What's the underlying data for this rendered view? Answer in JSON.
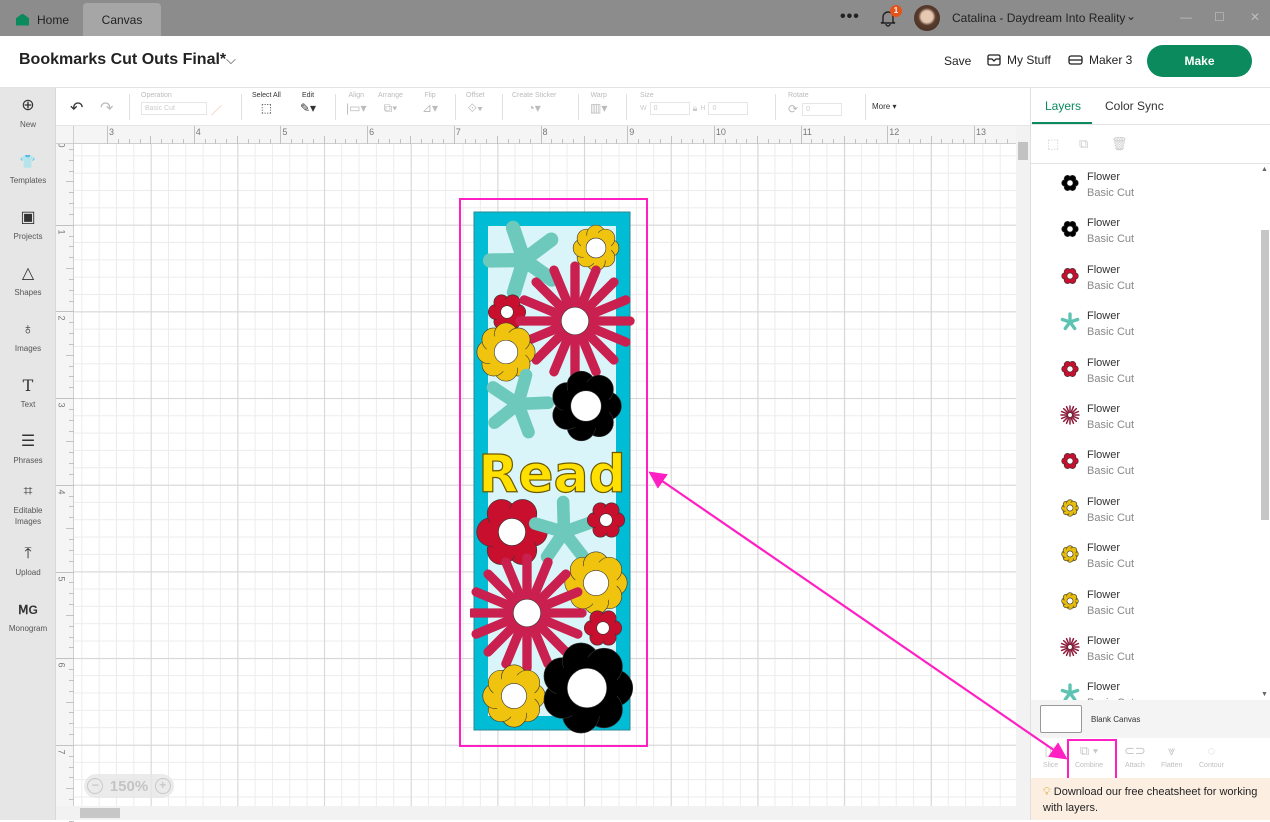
{
  "titlebar": {
    "tabs": [
      {
        "label": "Home"
      },
      {
        "label": "Canvas"
      }
    ],
    "more_label": "•••",
    "notification_count": "1",
    "user_name": "Catalina - Daydream Into Reality",
    "window_controls": [
      "—",
      "☐",
      "✕"
    ]
  },
  "header": {
    "project_title": "Bookmarks Cut Outs Final*",
    "save_label": "Save",
    "mystuff_label": "My Stuff",
    "machine_label": "Maker 3",
    "make_label": "Make"
  },
  "sidebar": {
    "items": [
      {
        "label": "New",
        "icon": "⊕"
      },
      {
        "label": "Templates",
        "icon": "👕"
      },
      {
        "label": "Projects",
        "icon": "▣"
      },
      {
        "label": "Shapes",
        "icon": "△"
      },
      {
        "label": "Images",
        "icon": "♁"
      },
      {
        "label": "Text",
        "icon": "T"
      },
      {
        "label": "Phrases",
        "icon": "☰"
      },
      {
        "label": "Editable Images",
        "icon": "⌗"
      },
      {
        "label": "Upload",
        "icon": "⤒"
      },
      {
        "label": "Monogram",
        "icon": "ⅯG"
      }
    ]
  },
  "toolbar": {
    "undo": "↶",
    "redo": "↷",
    "operation_label": "Operation",
    "operation_value": "Basic Cut",
    "select_all_label": "Select All",
    "edit_label": "Edit",
    "align_label": "Align",
    "arrange_label": "Arrange",
    "flip_label": "Flip",
    "offset_label": "Offset",
    "sticker_label": "Create Sticker",
    "warp_label": "Warp",
    "size_label": "Size",
    "width_prefix": "W",
    "width_value": "0",
    "height_prefix": "H",
    "height_value": "0",
    "rotate_label": "Rotate",
    "rotate_value": "0",
    "more_label": "More ▾"
  },
  "canvas": {
    "ruler_top": [
      "3",
      "4",
      "5",
      "6",
      "7",
      "8",
      "9",
      "10",
      "11",
      "12",
      "13"
    ],
    "ruler_left": [
      "0",
      "1",
      "2",
      "3",
      "4",
      "5",
      "6",
      "7"
    ],
    "zoom_level": "150%",
    "bookmark_text": "Read",
    "colors": {
      "frame": "#00bcd4",
      "teal": "#6cc9bb",
      "yellow": "#f0c30f",
      "red": "#c8102e",
      "magenta": "#c9204f",
      "black": "#000000",
      "text_yellow": "#ffe000",
      "highlight": "#ff1fc3"
    }
  },
  "panel": {
    "tabs": [
      {
        "label": "Layers"
      },
      {
        "label": "Color Sync"
      }
    ],
    "layers": [
      {
        "name": "Flower",
        "operation": "Basic Cut",
        "icon": "flower-round",
        "color": "#000000"
      },
      {
        "name": "Flower",
        "operation": "Basic Cut",
        "icon": "flower-round",
        "color": "#000000"
      },
      {
        "name": "Flower",
        "operation": "Basic Cut",
        "icon": "flower-round",
        "color": "#c8102e"
      },
      {
        "name": "Flower",
        "operation": "Basic Cut",
        "icon": "star",
        "color": "#5fc3b3"
      },
      {
        "name": "Flower",
        "operation": "Basic Cut",
        "icon": "flower-round",
        "color": "#c8102e"
      },
      {
        "name": "Flower",
        "operation": "Basic Cut",
        "icon": "daisy",
        "color": "#8e1d3c"
      },
      {
        "name": "Flower",
        "operation": "Basic Cut",
        "icon": "flower-round",
        "color": "#c8102e"
      },
      {
        "name": "Flower",
        "operation": "Basic Cut",
        "icon": "flower-scallop",
        "color": "#e6bd0c"
      },
      {
        "name": "Flower",
        "operation": "Basic Cut",
        "icon": "flower-scallop",
        "color": "#e6bd0c"
      },
      {
        "name": "Flower",
        "operation": "Basic Cut",
        "icon": "flower-scallop",
        "color": "#e6bd0c"
      },
      {
        "name": "Flower",
        "operation": "Basic Cut",
        "icon": "daisy",
        "color": "#8e1d3c"
      },
      {
        "name": "Flower",
        "operation": "Basic Cut",
        "icon": "star",
        "color": "#5fc3b3"
      }
    ],
    "blank_canvas_label": "Blank Canvas",
    "actions": [
      {
        "label": "Slice",
        "icon": "◫"
      },
      {
        "label": "Combine",
        "icon": "⧉ ▾"
      },
      {
        "label": "Attach",
        "icon": "⊂⊃"
      },
      {
        "label": "Flatten",
        "icon": "⩔"
      },
      {
        "label": "Contour",
        "icon": "◌"
      }
    ],
    "tip_text": "Download our free cheatsheet for working with layers."
  }
}
